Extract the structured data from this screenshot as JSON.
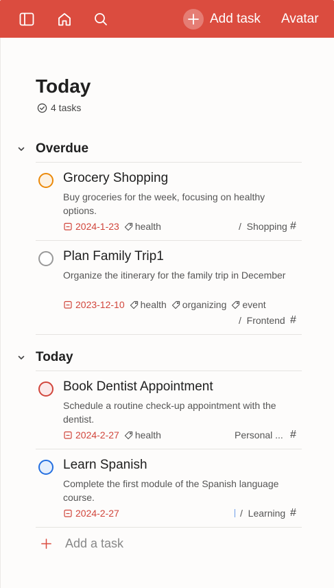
{
  "topbar": {
    "add_task_label": "Add task",
    "avatar_label": "Avatar",
    "icons": [
      "sidebar-toggle-icon",
      "home-icon",
      "search-icon",
      "plus-icon"
    ],
    "color": "#db4c3f"
  },
  "page": {
    "title": "Today",
    "task_count": "4 tasks"
  },
  "sections": [
    {
      "title": "Overdue",
      "tasks": [
        {
          "title": "Grocery Shopping",
          "description": "Buy groceries for the week, focusing on healthy options.",
          "date": "2024-1-23",
          "labels": [
            "health"
          ],
          "project": "Shopping",
          "project_prefix": "/",
          "check_color": "#eb8909"
        },
        {
          "title": "Plan Family Trip1",
          "description": "Organize the itinerary for the family trip in December",
          "date": "2023-12-10",
          "labels": [
            "health",
            "organizing",
            "event"
          ],
          "project": "Frontend",
          "project_prefix": "/",
          "check_color": "#999999"
        }
      ]
    },
    {
      "title": "Today",
      "tasks": [
        {
          "title": "Book Dentist Appointment",
          "description": "Schedule a routine check-up appointment with the dentist.",
          "date": "2024-2-27",
          "labels": [
            "health"
          ],
          "project": "Personal ...",
          "project_prefix": "",
          "check_color": "#d1453b"
        },
        {
          "title": "Learn Spanish",
          "description": "Complete the first module of the Spanish language course.",
          "date": "2024-2-27",
          "labels": [],
          "project": "Learning",
          "project_prefix": "/",
          "check_color": "#246fe0"
        }
      ]
    }
  ],
  "footer": {
    "add_task_label": "Add a task"
  },
  "colors": {
    "accent": "#db4c3f",
    "date": "#d1453b"
  }
}
